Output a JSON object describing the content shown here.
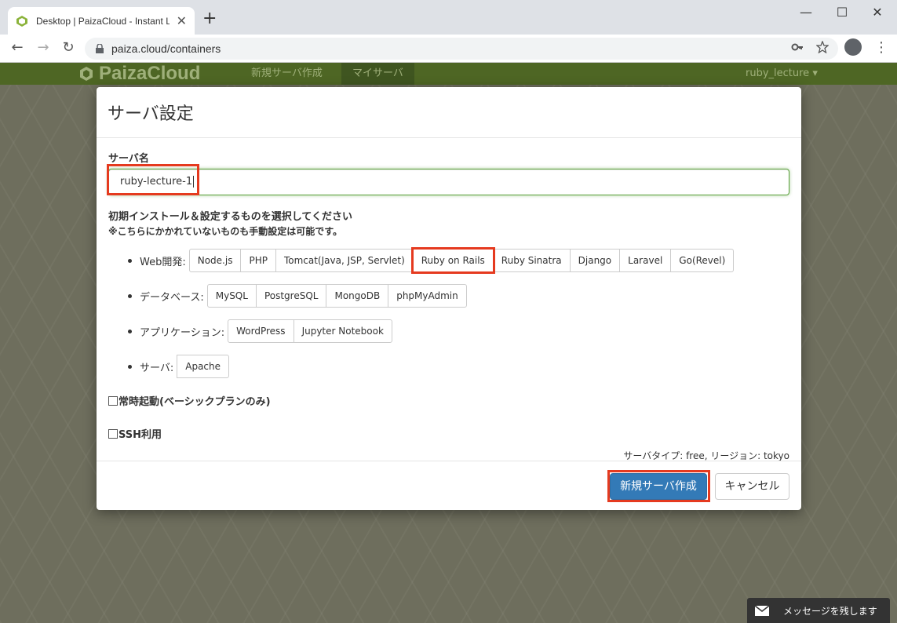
{
  "browser": {
    "tab_title": "Desktop | PaizaCloud - Instant Linux",
    "tab_close": "✕",
    "new_tab": "+",
    "url": "paiza.cloud/containers",
    "window_controls": {
      "minimize": "—",
      "maximize": "☐",
      "close": "✕"
    },
    "nav": {
      "back": "←",
      "forward": "→",
      "reload": "↻"
    }
  },
  "site_nav": {
    "logo": "PaizaCloud",
    "links": [
      "新規サーバ作成",
      "マイサーバ"
    ],
    "active_index": 1,
    "user": "ruby_lecture ▾"
  },
  "modal": {
    "title": "サーバ設定",
    "server_name_label": "サーバ名",
    "server_name_value": "ruby-lecture-1",
    "select_label": "初期インストール＆設定するものを選択してください",
    "note": "※こちらにかかれていないものも手動設定は可能です。",
    "categories": [
      {
        "label": "Web開発:",
        "options": [
          "Node.js",
          "PHP",
          "Tomcat(Java, JSP, Servlet)",
          "Ruby on Rails",
          "Ruby Sinatra",
          "Django",
          "Laravel",
          "Go(Revel)"
        ],
        "highlighted": "Ruby on Rails"
      },
      {
        "label": "データベース:",
        "options": [
          "MySQL",
          "PostgreSQL",
          "MongoDB",
          "phpMyAdmin"
        ]
      },
      {
        "label": "アプリケーション:",
        "options": [
          "WordPress",
          "Jupyter Notebook"
        ]
      },
      {
        "label": "サーバ:",
        "options": [
          "Apache"
        ]
      }
    ],
    "always_on_label": "常時起動(ベーシックプランのみ)",
    "ssh_label": "SSH利用",
    "server_type": "サーバタイプ: free, リージョン: tokyo",
    "create_button": "新規サーバ作成",
    "cancel_button": "キャンセル"
  },
  "message_widget": {
    "label": "メッセージを残します"
  },
  "colors": {
    "accent_highlight": "#e53a1f",
    "primary": "#337ab7",
    "navbar": "#4e6624"
  }
}
